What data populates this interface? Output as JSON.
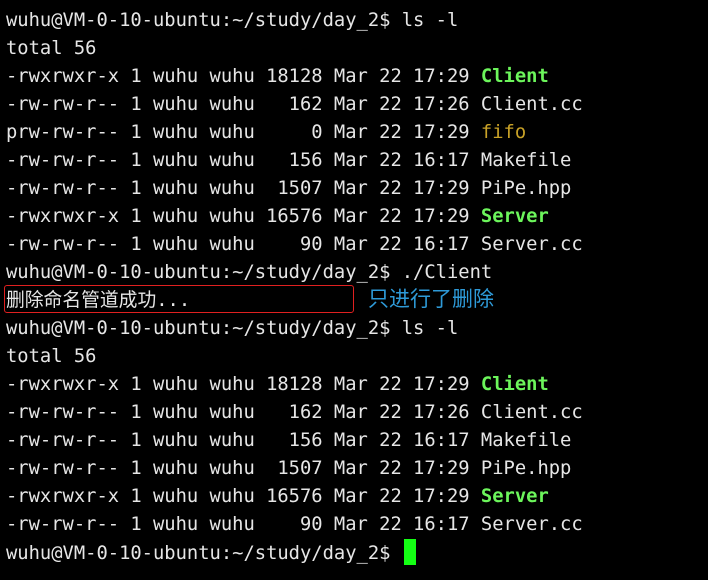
{
  "session1": {
    "prompt": "wuhu@VM-0-10-ubuntu:~/study/day_2$ ls -l",
    "total": "total 56",
    "entries": [
      {
        "meta": "-rwxrwxr-x 1 wuhu wuhu 18128 Mar 22 17:29 ",
        "name": "Client"
      },
      {
        "meta": "-rw-rw-r-- 1 wuhu wuhu   162 Mar 22 17:26 ",
        "name": "Client.cc"
      },
      {
        "meta": "prw-rw-r-- 1 wuhu wuhu     0 Mar 22 17:29 ",
        "name": "fifo"
      },
      {
        "meta": "-rw-rw-r-- 1 wuhu wuhu   156 Mar 22 16:17 ",
        "name": "Makefile"
      },
      {
        "meta": "-rw-rw-r-- 1 wuhu wuhu  1507 Mar 22 17:29 ",
        "name": "PiPe.hpp"
      },
      {
        "meta": "-rwxrwxr-x 1 wuhu wuhu 16576 Mar 22 17:29 ",
        "name": "Server"
      },
      {
        "meta": "-rw-rw-r-- 1 wuhu wuhu    90 Mar 22 16:17 ",
        "name": "Server.cc"
      }
    ]
  },
  "run": {
    "prompt": "wuhu@VM-0-10-ubuntu:~/study/day_2$ ./Client",
    "output": "删除命名管道成功..."
  },
  "annotation": {
    "text": "只进行了删除",
    "box_color": "#e02020",
    "text_color": "#2e9ad8"
  },
  "session2": {
    "prompt": "wuhu@VM-0-10-ubuntu:~/study/day_2$ ls -l",
    "total": "total 56",
    "entries": [
      {
        "meta": "-rwxrwxr-x 1 wuhu wuhu 18128 Mar 22 17:29 ",
        "name": "Client"
      },
      {
        "meta": "-rw-rw-r-- 1 wuhu wuhu   162 Mar 22 17:26 ",
        "name": "Client.cc"
      },
      {
        "meta": "-rw-rw-r-- 1 wuhu wuhu   156 Mar 22 16:17 ",
        "name": "Makefile"
      },
      {
        "meta": "-rw-rw-r-- 1 wuhu wuhu  1507 Mar 22 17:29 ",
        "name": "PiPe.hpp"
      },
      {
        "meta": "-rwxrwxr-x 1 wuhu wuhu 16576 Mar 22 17:29 ",
        "name": "Server"
      },
      {
        "meta": "-rw-rw-r-- 1 wuhu wuhu    90 Mar 22 16:17 ",
        "name": "Server.cc"
      }
    ]
  },
  "final_prompt": "wuhu@VM-0-10-ubuntu:~/study/day_2$ ",
  "colors": {
    "executable": "#6cf55b",
    "fifo": "#c9a227",
    "cursor": "#14ff14",
    "text": "#e6e6e6",
    "background": "#000000"
  }
}
